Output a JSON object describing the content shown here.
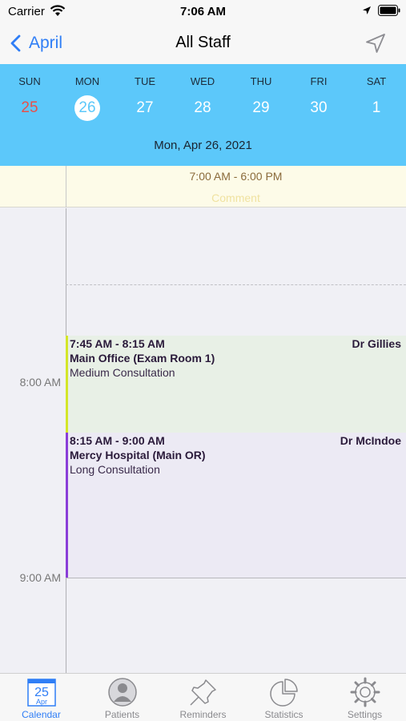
{
  "status_bar": {
    "carrier": "Carrier",
    "time": "7:06 AM"
  },
  "nav": {
    "back_label": "April",
    "title": "All Staff"
  },
  "week": {
    "days": [
      {
        "name": "SUN",
        "num": "25"
      },
      {
        "name": "MON",
        "num": "26"
      },
      {
        "name": "TUE",
        "num": "27"
      },
      {
        "name": "WED",
        "num": "28"
      },
      {
        "name": "THU",
        "num": "29"
      },
      {
        "name": "FRI",
        "num": "30"
      },
      {
        "name": "SAT",
        "num": "1"
      }
    ],
    "selected_index": 1,
    "selected_date": "Mon, Apr 26, 2021"
  },
  "hours_banner": {
    "hours": "7:00 AM - 6:00 PM",
    "comment": "Comment"
  },
  "timeline": {
    "hour_labels": [
      "8:00 AM",
      "9:00 AM"
    ],
    "appointments": [
      {
        "time": "7:45 AM - 8:15 AM",
        "doctor": "Dr Gillies",
        "place": "Main Office (Exam Room 1)",
        "type": "Medium Consultation",
        "color": "#d4e628"
      },
      {
        "time": "8:15 AM - 9:00 AM",
        "doctor": "Dr McIndoe",
        "place": "Mercy Hospital (Main OR)",
        "type": "Long Consultation",
        "color": "#8a3ed8"
      }
    ]
  },
  "tabs": [
    {
      "label": "Calendar",
      "icon": "calendar-icon",
      "active": true,
      "calendar_day": "25",
      "calendar_month": "Apr"
    },
    {
      "label": "Patients",
      "icon": "person-icon",
      "active": false
    },
    {
      "label": "Reminders",
      "icon": "pin-icon",
      "active": false
    },
    {
      "label": "Statistics",
      "icon": "pie-chart-icon",
      "active": false
    },
    {
      "label": "Settings",
      "icon": "gear-icon",
      "active": false
    }
  ],
  "colors": {
    "accent": "#2f7ef6",
    "header_blue": "#5cc8fa",
    "sunday_red": "#e8504a"
  }
}
